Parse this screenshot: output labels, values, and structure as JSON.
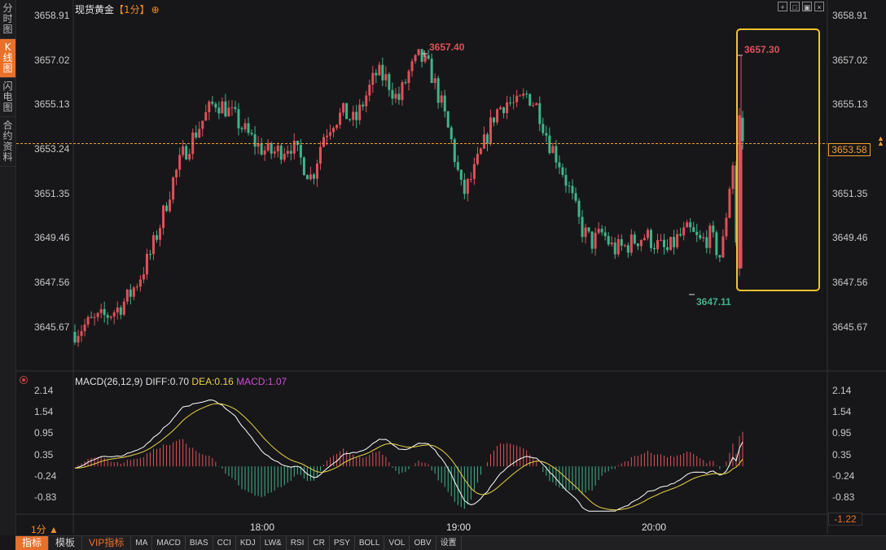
{
  "sidebar": {
    "tabs": [
      {
        "label": "分时图",
        "active": false
      },
      {
        "label": "K线图",
        "active": true
      },
      {
        "label": "闪电图",
        "active": false
      },
      {
        "label": "合约资料",
        "active": false
      }
    ]
  },
  "header": {
    "title": "现货黄金",
    "period": "【1分】",
    "add_icon": "⊕"
  },
  "toolbar_icons": [
    "crosshair-icon",
    "expand-icon",
    "restore-icon",
    "close-icon"
  ],
  "price_axis": {
    "left_labels": [
      "3658.91",
      "3657.02",
      "3655.13",
      "3653.24",
      "3651.35",
      "3649.46",
      "3647.56",
      "3645.67"
    ],
    "right_labels": [
      "3658.91",
      "3657.02",
      "3655.13",
      "3653.24",
      "3651.35",
      "3649.46",
      "3647.56",
      "3645.67"
    ],
    "current_price": "3653.58"
  },
  "annotations": {
    "high_label": "3657.40",
    "low_label": "3647.11",
    "spike_high_label": "3657.30"
  },
  "macd": {
    "header_name": "MACD(26,12,9)",
    "diff": "DIFF:0.70",
    "dea": "DEA:0.16",
    "macd": "MACD:1.07",
    "left_labels": [
      "2.14",
      "1.54",
      "0.95",
      "0.35",
      "-0.24",
      "-0.83"
    ],
    "right_labels": [
      "2.14",
      "1.54",
      "0.95",
      "0.35",
      "-0.24",
      "-0.83"
    ],
    "right_extra": "-1.22"
  },
  "time_axis": {
    "labels": [
      "18:00",
      "19:00",
      "20:00"
    ],
    "period_label": "1分 ▲"
  },
  "bottom_tabs": [
    {
      "label": "指标",
      "active": true,
      "vip": false
    },
    {
      "label": "模板",
      "active": false,
      "vip": false
    },
    {
      "label": "VIP指标",
      "active": false,
      "vip": true
    },
    {
      "label": "MA",
      "active": false,
      "vip": false
    },
    {
      "label": "MACD",
      "active": false,
      "vip": false
    },
    {
      "label": "BIAS",
      "active": false,
      "vip": false
    },
    {
      "label": "CCI",
      "active": false,
      "vip": false
    },
    {
      "label": "KDJ",
      "active": false,
      "vip": false
    },
    {
      "label": "LW&",
      "active": false,
      "vip": false
    },
    {
      "label": "RSI",
      "active": false,
      "vip": false
    },
    {
      "label": "CR",
      "active": false,
      "vip": false
    },
    {
      "label": "PSY",
      "active": false,
      "vip": false
    },
    {
      "label": "BOLL",
      "active": false,
      "vip": false
    },
    {
      "label": "VOL",
      "active": false,
      "vip": false
    },
    {
      "label": "OBV",
      "active": false,
      "vip": false
    },
    {
      "label": "设置",
      "active": false,
      "vip": false
    }
  ],
  "colors": {
    "up": "#e0505a",
    "down": "#3fb58a",
    "highlight": "#f5c230",
    "current_line": "#f0a030",
    "diff": "#ffffff",
    "dea": "#e8d24a"
  },
  "chart_data": {
    "type": "candlestick",
    "ylim": [
      3645.67,
      3658.91
    ],
    "series_desc": "1-minute XAU spot, approx 17:30–20:55",
    "price_path": [
      3645.5,
      3645.8,
      3646.0,
      3646.2,
      3646.5,
      3647.0,
      3647.8,
      3648.8,
      3650.2,
      3651.8,
      3653.0,
      3653.8,
      3654.6,
      3655.3,
      3655.0,
      3654.5,
      3653.9,
      3653.4,
      3653.1,
      3653.2,
      3653.5,
      3652.8,
      3652.0,
      3653.8,
      3654.5,
      3654.8,
      3654.4,
      3655.5,
      3656.5,
      3656.2,
      3655.3,
      3656.5,
      3657.2,
      3656.6,
      3655.2,
      3653.5,
      3651.3,
      3652.2,
      3653.5,
      3654.8,
      3655.3,
      3655.1,
      3655.6,
      3655.0,
      3653.6,
      3652.7,
      3651.4,
      3649.9,
      3649.3,
      3649.7,
      3649.0,
      3649.1,
      3649.4,
      3649.6,
      3649.2,
      3648.9,
      3649.5,
      3649.8,
      3649.3,
      3649.6,
      3648.6,
      3652.6,
      3653.6
    ]
  }
}
